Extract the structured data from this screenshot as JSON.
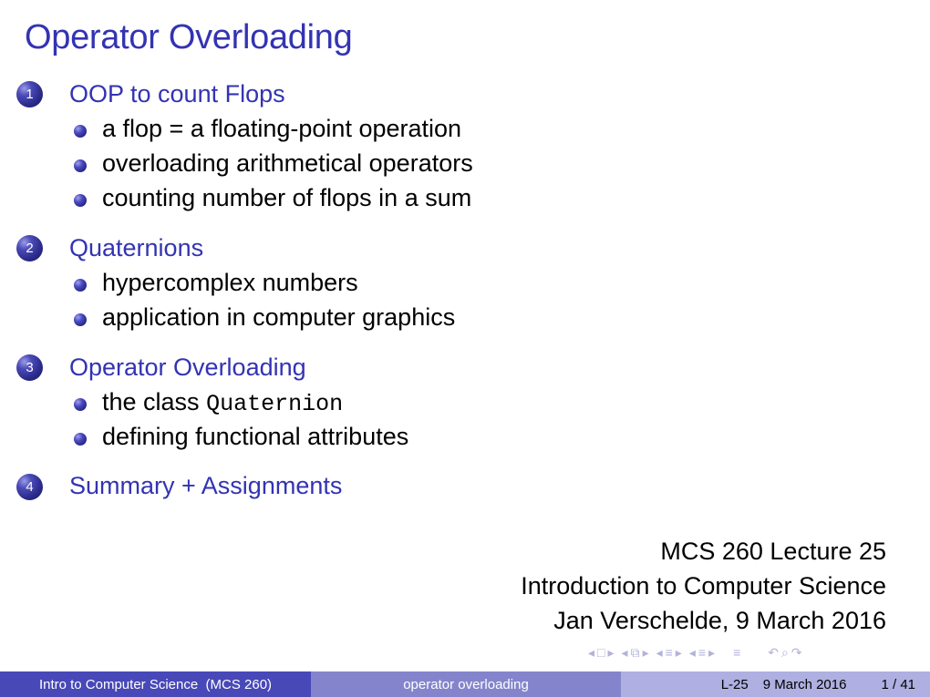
{
  "slide": {
    "title": "Operator Overloading"
  },
  "outline": [
    {
      "number": "1",
      "title": "OOP to count Flops",
      "items": [
        {
          "text": "a flop = a floating-point operation"
        },
        {
          "text": "overloading arithmetical operators"
        },
        {
          "text": "counting number of flops in a sum"
        }
      ]
    },
    {
      "number": "2",
      "title": "Quaternions",
      "items": [
        {
          "text": "hypercomplex numbers"
        },
        {
          "text": "application in computer graphics"
        }
      ]
    },
    {
      "number": "3",
      "title": "Operator Overloading",
      "items": [
        {
          "text": "the class ",
          "code": "Quaternion"
        },
        {
          "text": "defining functional attributes"
        }
      ]
    },
    {
      "number": "4",
      "title": "Summary + Assignments",
      "items": []
    }
  ],
  "info": {
    "line1": "MCS 260 Lecture 25",
    "line2": "Introduction to Computer Science",
    "line3": "Jan Verschelde, 9 March 2016"
  },
  "nav_icons": {
    "prev_frame": "◂",
    "frame": "□",
    "next_frame": "▸",
    "prev_subsection": "◂",
    "subsection": "⧉",
    "next_subsection": "▸",
    "prev_section": "◂",
    "section": "≡",
    "next_section": "▸",
    "prev_doc": "◂",
    "doc": "≡",
    "next_doc": "▸",
    "appendix": "≡",
    "back": "↶",
    "search": "⌕",
    "forward": "↷"
  },
  "footer": {
    "course": "Intro to Computer Science  (MCS 260)",
    "topic": "operator overloading",
    "lecture": "L-25",
    "date": "9 March 2016",
    "page": "1 / 41"
  },
  "colors": {
    "accent": "#3333b3",
    "footer_dark": "#4848b8",
    "footer_mid": "#8484cd",
    "footer_light": "#afafe1"
  }
}
